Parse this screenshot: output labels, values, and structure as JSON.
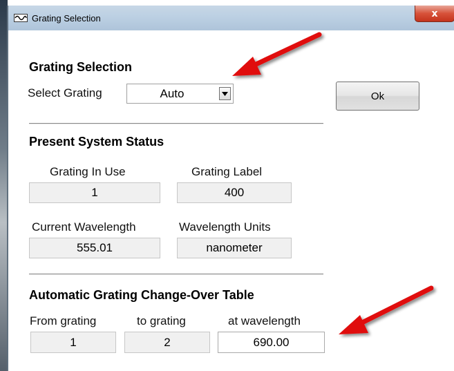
{
  "window": {
    "title": "Grating Selection",
    "close_label": "x"
  },
  "grating_selection": {
    "heading": "Grating Selection",
    "select_label": "Select Grating",
    "select_value": "Auto",
    "ok_label": "Ok"
  },
  "status": {
    "heading": "Present System Status",
    "grating_in_use_label": "Grating In Use",
    "grating_in_use_value": "1",
    "grating_label_label": "Grating Label",
    "grating_label_value": "400",
    "current_wavelength_label": "Current Wavelength",
    "current_wavelength_value": "555.01",
    "wavelength_units_label": "Wavelength Units",
    "wavelength_units_value": "nanometer"
  },
  "changeover": {
    "heading": "Automatic Grating Change-Over Table",
    "from_label": "From grating",
    "from_value": "1",
    "to_label": "to grating",
    "to_value": "2",
    "at_label": "at wavelength",
    "at_value": "690.00"
  },
  "colors": {
    "annotation_arrow": "#e01010"
  }
}
